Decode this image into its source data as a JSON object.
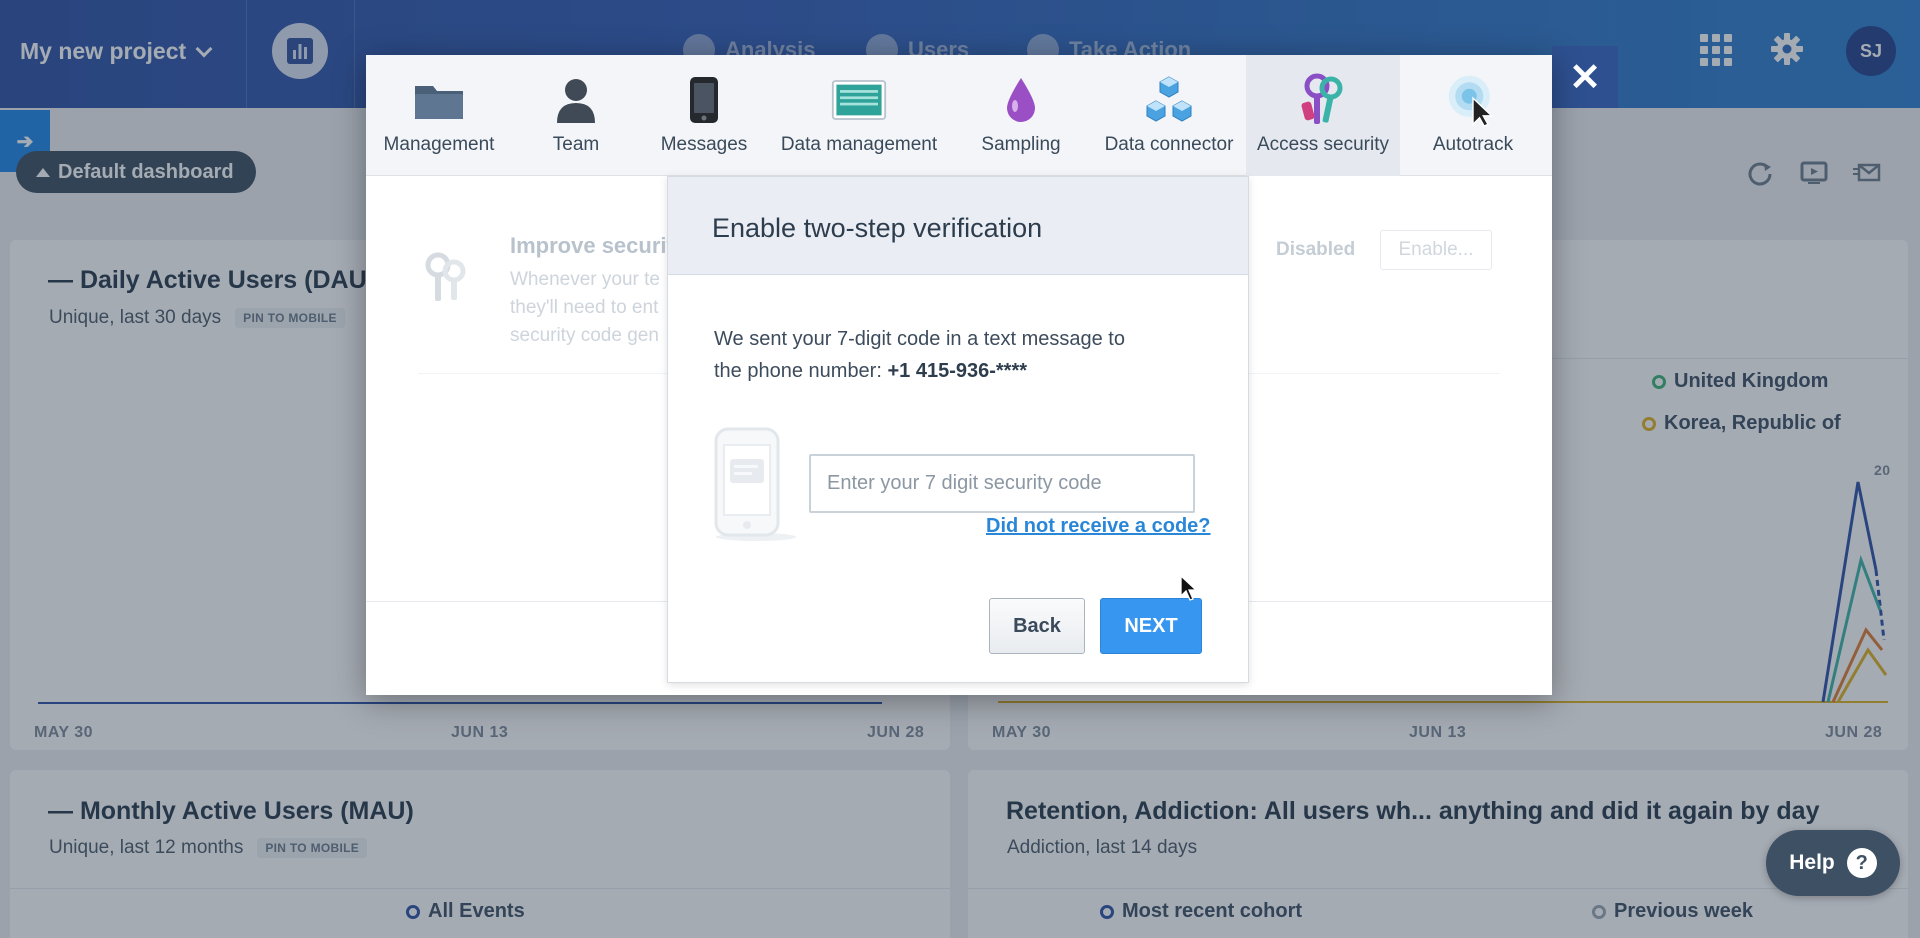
{
  "topbar": {
    "project_name": "My new project",
    "nav": [
      "Analysis",
      "Users",
      "Take Action"
    ],
    "avatar_initials": "SJ"
  },
  "dashboard": {
    "pill_label": "Default dashboard",
    "cards": {
      "dau": {
        "title": "Daily Active Users (DAU)",
        "subtitle": "Unique, last 30 days",
        "pin": "PIN TO MOBILE",
        "axis": [
          "MAY 30",
          "JUN 13",
          "JUN 28"
        ]
      },
      "geo": {
        "legend": [
          "United Kingdom",
          "Korea, Republic of"
        ],
        "y_max_label": "20",
        "axis": [
          "MAY 30",
          "JUN 13",
          "JUN 28"
        ]
      },
      "mau": {
        "title": "Monthly Active Users (MAU)",
        "subtitle": "Unique, last 12 months",
        "pin": "PIN TO MOBILE",
        "legend": "All Events"
      },
      "retention": {
        "title": "Retention, Addiction: All users wh... anything and did it again by day",
        "subtitle": "Addiction, last 14 days",
        "legend": [
          "Most recent cohort",
          "Previous week"
        ]
      }
    }
  },
  "settings": {
    "tabs": [
      {
        "label": "Management",
        "icon": "folder-icon"
      },
      {
        "label": "Team",
        "icon": "person-icon"
      },
      {
        "label": "Messages",
        "icon": "phone-icon"
      },
      {
        "label": "Data management",
        "icon": "terminal-icon"
      },
      {
        "label": "Sampling",
        "icon": "droplet-icon"
      },
      {
        "label": "Data connector",
        "icon": "cubes-icon"
      },
      {
        "label": "Access security",
        "icon": "keys-icon"
      },
      {
        "label": "Autotrack",
        "icon": "target-cursor-icon"
      }
    ],
    "active_tab": "Access security",
    "background_row": {
      "title": "Improve security",
      "text_line1": "Whenever your te",
      "text_line2": "they'll need to ent",
      "text_line3": "security code gen",
      "status": "Disabled",
      "button": "Enable..."
    }
  },
  "tfa": {
    "title": "Enable two-step verification",
    "message_prefix": "We sent your 7-digit code in a text message to the phone number: ",
    "phone": "+1 415-936-****",
    "input_placeholder": "Enter your 7 digit security code",
    "input_value": "",
    "resend_link": "Did not receive a code?",
    "back_label": "Back",
    "next_label": "NEXT"
  },
  "help_label": "Help",
  "colors": {
    "accent": "#3796ef",
    "link": "#2a87d8",
    "nav_gradient_start": "#2c4fa3",
    "nav_gradient_end": "#2b7fcf",
    "legend_uk": "#3bb273",
    "legend_korea": "#e0b020",
    "legend_all_events": "#2a4fa6",
    "legend_recent": "#2a4fa6",
    "legend_previous": "#9aa5b1"
  }
}
